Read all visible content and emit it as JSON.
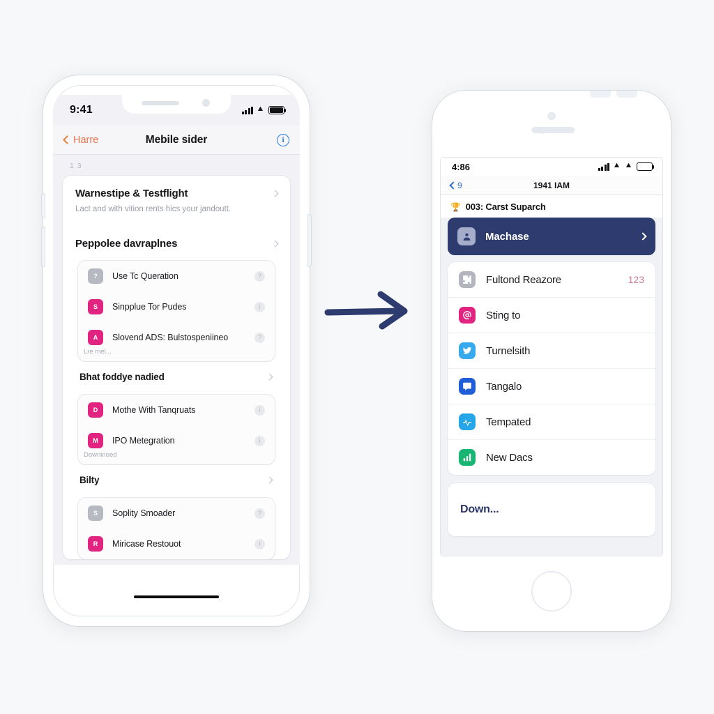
{
  "canvas": {
    "background": "#f7f8f9",
    "arrow_color": "#2e3b6e"
  },
  "left_phone": {
    "status_bar": {
      "time": "9:41",
      "signal_icon": "signal-bars-icon",
      "wifi_icon": "wifi-icon",
      "battery_icon": "battery-full-icon"
    },
    "nav_bar": {
      "back_label": "Harre",
      "title": "Mebile sider",
      "info_icon": "info-circle-icon",
      "accent": "#e8744d"
    },
    "tiny_label": "1 3",
    "hero": {
      "title": "Warnestipe & Testflight",
      "subtitle": "Lact and with vition rents hics your jandoutt.",
      "section_label": "Peppolee davraplnes"
    },
    "group_1": {
      "rows": [
        {
          "label": "Use Tc Queration",
          "icon_color": "#b6b9c1",
          "icon_glyph": "?",
          "badge": "?"
        },
        {
          "label": "Sinpplue Tor Pudes",
          "icon_color": "#e0247f",
          "icon_glyph": "S",
          "badge": "i"
        },
        {
          "label": "Slovend ADS: Bulstospeniineo",
          "icon_color": "#e0247f",
          "icon_glyph": "A",
          "badge": "?"
        }
      ],
      "note": "Lre mel..."
    },
    "section_2_label": "Bhat foddye nadied",
    "group_2": {
      "rows": [
        {
          "label": "Mothe With Tanqruats",
          "icon_color": "#e0247f",
          "icon_glyph": "D",
          "badge": "i"
        },
        {
          "label": "IPO Metegration",
          "icon_color": "#e0247f",
          "icon_glyph": "M",
          "badge": "i"
        }
      ],
      "note": "Downinoed"
    },
    "section_3_label": "Bilty",
    "group_3": {
      "rows": [
        {
          "label": "Soplity Smoader",
          "icon_color": "#b6b9c1",
          "icon_glyph": "S",
          "badge": "?"
        },
        {
          "label": "Miricase Restouot",
          "icon_color": "#e0247f",
          "icon_glyph": "R",
          "badge": "i"
        }
      ]
    }
  },
  "right_phone": {
    "status_bar": {
      "time": "4:86",
      "signal_icon": "signal-bars-icon",
      "wifi_icon_1": "wifi-icon",
      "wifi_icon_2": "wifi-icon",
      "battery_icon": "battery-empty-icon"
    },
    "nav_bar": {
      "back_label": "9",
      "title": "1941 IAM",
      "accent": "#2f6fd0"
    },
    "section_title": {
      "text": "003: Carst Suparch",
      "icon": "trophy-icon"
    },
    "highlight_row": {
      "label": "Machase",
      "icon": "person-icon",
      "bg": "#2e3b6e",
      "chevron": "chevron-right-icon"
    },
    "list_rows": [
      {
        "label": "Fultond Reazore",
        "count": "123",
        "icon_color": "#b2b5bd",
        "icon": "puzzle-icon"
      },
      {
        "label": "Sting to",
        "count": "",
        "icon_color": "#e0247f",
        "icon": "at-icon"
      },
      {
        "label": "Turnelsith",
        "count": "",
        "icon_color": "#37a9ec",
        "icon": "bird-icon"
      },
      {
        "label": "Tangalo",
        "count": "",
        "icon_color": "#1f5ed6",
        "icon": "chat-icon"
      },
      {
        "label": "Tempated",
        "count": "",
        "icon_color": "#26a6e8",
        "icon": "pulse-icon"
      },
      {
        "label": "New Dacs",
        "count": "",
        "icon_color": "#19b573",
        "icon": "bars-icon"
      }
    ],
    "footer_card": {
      "label": "Down..."
    },
    "home_button": "home-button-icon"
  }
}
